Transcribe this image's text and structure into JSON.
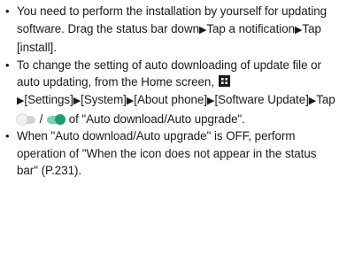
{
  "bullet": "•",
  "items": [
    {
      "text_1": "You need to perform the installation by yourself for updating software. Drag the status bar down",
      "arrow": "▶",
      "text_2": "Tap a notification",
      "text_3": "Tap [install]."
    },
    {
      "text_1": "To change the setting of auto downloading of update file or auto updating, from the Home screen,",
      "apps_icon": "apps-grid-icon",
      "text_2": "[Settings]",
      "text_3": "[System]",
      "text_4": "[About phone]",
      "text_5": "[Software Update]",
      "text_6": "Tap",
      "slash": "/",
      "text_7": "of \"Auto download/Auto upgrade\".",
      "toggle_off_icon": "toggle-off-icon",
      "toggle_on_icon": "toggle-on-icon"
    },
    {
      "text_1": "When \"Auto download/Auto upgrade\" is OFF, perform operation of \"When the icon does not appear in the status bar\" (P.231)."
    }
  ],
  "colors": {
    "text": "#1a1a1a",
    "toggle_on_knob": "#1f9c76",
    "toggle_on_track": "#7fcfb7",
    "toggle_off_track": "#d4d4d4"
  }
}
